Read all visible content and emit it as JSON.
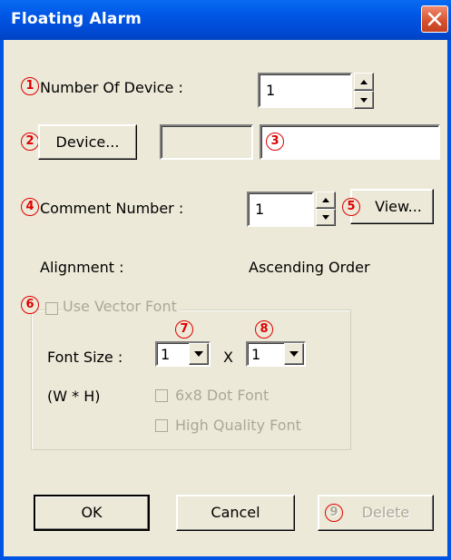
{
  "window": {
    "title": "Floating Alarm"
  },
  "markers": [
    "1",
    "2",
    "3",
    "4",
    "5",
    "6",
    "7",
    "8",
    "9"
  ],
  "number_of_device": {
    "label": "Number Of Device :",
    "value": "1"
  },
  "device": {
    "button_label": "Device...",
    "field1_value": "",
    "field2_value": ""
  },
  "comment_number": {
    "label": "Comment Number :",
    "value": "1",
    "view_label": "View..."
  },
  "alignment": {
    "label": "Alignment :",
    "value": "Ascending Order"
  },
  "vector_font": {
    "label": "Use Vector Font",
    "font_size_label": "Font Size :",
    "wh_label": "(W * H)",
    "width_value": "1",
    "x_label": "X",
    "height_value": "1",
    "dot_font_label": "6x8 Dot Font",
    "high_quality_label": "High Quality Font"
  },
  "buttons": {
    "ok": "OK",
    "cancel": "Cancel",
    "delete": "Delete"
  }
}
